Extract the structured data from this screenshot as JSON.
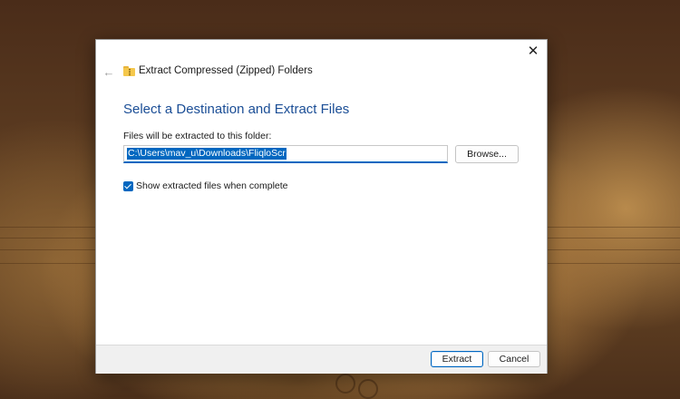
{
  "dialog": {
    "title": "Extract Compressed (Zipped) Folders",
    "heading": "Select a Destination and Extract Files",
    "field_label": "Files will be extracted to this folder:",
    "path_value": "C:\\Users\\mav_u\\Downloads\\FliqloScr",
    "browse_label": "Browse...",
    "checkbox_label": "Show extracted files when complete",
    "checkbox_checked": true,
    "close_glyph": "✕",
    "back_glyph": "←",
    "icons": [
      "close-icon",
      "back-arrow-icon",
      "zip-folder-icon",
      "checkmark-icon"
    ]
  },
  "footer": {
    "extract_label": "Extract",
    "cancel_label": "Cancel"
  },
  "colors": {
    "accent": "#0067c0",
    "heading": "#1b4e96",
    "footer_bg": "#f0f0f0"
  }
}
